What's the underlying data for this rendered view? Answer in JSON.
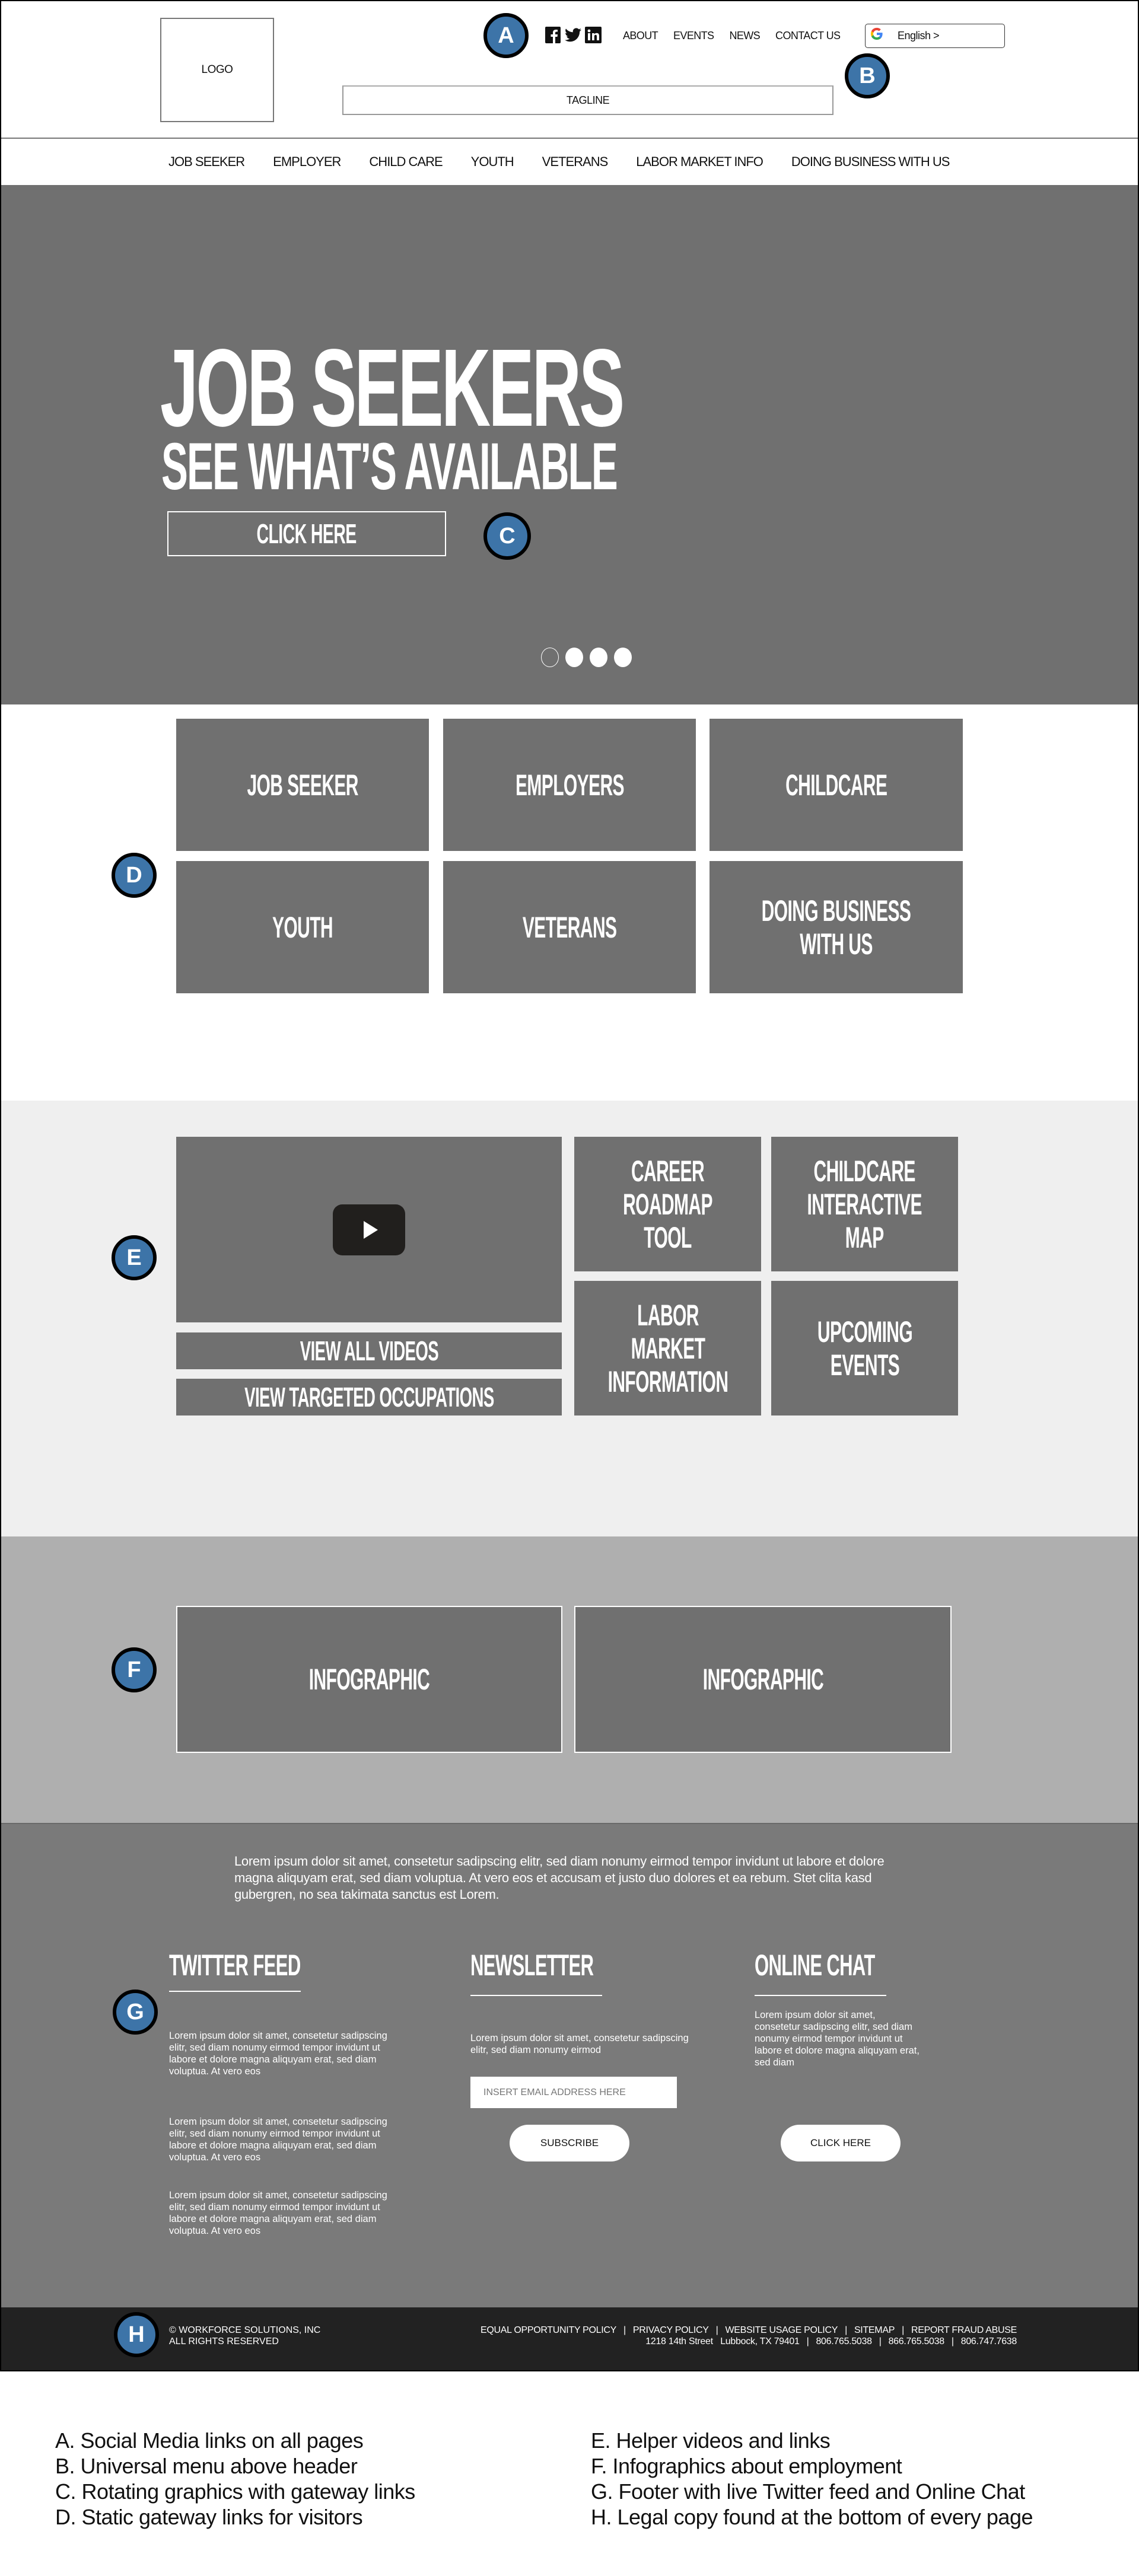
{
  "header": {
    "logo_label": "LOGO",
    "tagline": "TAGLINE",
    "social_icons": [
      "facebook-icon",
      "twitter-icon",
      "linkedin-icon"
    ],
    "utility_links": [
      "ABOUT",
      "EVENTS",
      "NEWS",
      "CONTACT US"
    ],
    "language": {
      "icon": "google-icon",
      "label": "English >"
    }
  },
  "main_nav": [
    "JOB SEEKER",
    "EMPLOYER",
    "CHILD CARE",
    "YOUTH",
    "VETERANS",
    "LABOR MARKET INFO",
    "DOING BUSINESS WITH US"
  ],
  "hero": {
    "title": "JOB SEEKERS",
    "subtitle": "SEE WHAT’S AVAILABLE",
    "cta": "CLICK HERE",
    "slides_total": 4,
    "active_slide": 1
  },
  "gateway_tiles": [
    "JOB SEEKER",
    "EMPLOYERS",
    "CHILDCARE",
    "YOUTH",
    "VETERANS",
    "DOING BUSINESS WITH US"
  ],
  "helper": {
    "video_icon": "play-icon",
    "buttons": [
      "VIEW ALL VIDEOS",
      "VIEW TARGETED OCCUPATIONS"
    ],
    "tiles": [
      "CAREER ROADMAP TOOL",
      "CHILDCARE INTERACTIVE MAP",
      "LABOR MARKET INFORMATION",
      "UPCOMING EVENTS"
    ]
  },
  "infographics": [
    "INFOGRAPHIC",
    "INFOGRAPHIC"
  ],
  "footer": {
    "intro": "Lorem ipsum dolor sit amet, consetetur sadipscing elitr, sed diam nonumy eirmod tempor invidunt ut labore et dolore magna aliquyam erat, sed diam voluptua. At vero eos et accusam et justo duo dolores et ea rebum. Stet clita kasd gubergren, no sea takimata sanctus est Lorem.",
    "twitter": {
      "title": "TWITTER FEED",
      "posts": [
        "Lorem ipsum dolor sit amet, consetetur sadipscing elitr, sed diam nonumy eirmod tempor invidunt ut labore et dolore magna aliquyam erat, sed diam voluptua. At vero eos",
        "Lorem ipsum dolor sit amet, consetetur sadipscing elitr, sed diam nonumy eirmod tempor invidunt ut labore et dolore magna aliquyam erat, sed diam voluptua. At vero eos",
        "Lorem ipsum dolor sit amet, consetetur sadipscing elitr, sed diam nonumy eirmod tempor invidunt ut labore et dolore magna aliquyam erat, sed diam voluptua. At vero eos"
      ]
    },
    "newsletter": {
      "title": "NEWSLETTER",
      "text": "Lorem ipsum dolor sit amet, consetetur sadipscing elitr, sed diam nonumy eirmod",
      "email_placeholder": "INSERT EMAIL ADDRESS HERE",
      "button": "SUBSCRIBE"
    },
    "chat": {
      "title": "ONLINE CHAT",
      "text": "Lorem ipsum dolor sit amet, consetetur sadipscing elitr, sed diam nonumy eirmod tempor invidunt ut labore et dolore magna aliquyam erat, sed diam",
      "button": "CLICK HERE"
    }
  },
  "legal": {
    "copyright": "© WORKFORCE SOLUTIONS, INC",
    "rights": "ALL RIGHTS RESERVED",
    "links": [
      "EQUAL OPPORTUNITY POLICY",
      "PRIVACY POLICY",
      "WEBSITE USAGE POLICY",
      "SITEMAP",
      "REPORT FRAUD ABUSE"
    ],
    "address": "1218 14th Street   Lubbock, TX 79401",
    "phones": [
      "806.765.5038",
      "866.765.5038",
      "806.747.7638"
    ]
  },
  "badges": [
    "A",
    "B",
    "C",
    "D",
    "E",
    "F",
    "G",
    "H"
  ],
  "legend": {
    "left": [
      "A. Social Media links on all pages",
      "B. Universal menu above header",
      "C. Rotating graphics with gateway links",
      "D. Static gateway links for visitors"
    ],
    "right": [
      "E. Helper videos and links",
      "F. Infographics about employment",
      "G. Footer with live Twitter feed and Online Chat",
      "H. Legal copy found at the bottom of every page"
    ]
  },
  "colors": {
    "badge": "#3d74a8",
    "hero_bg": "#707070",
    "tile_bg": "#707070",
    "helper_bg": "#efefef",
    "infographic_bg": "#afafaf",
    "footer_bg": "#7a7a7a",
    "legal_bg": "#222222"
  }
}
